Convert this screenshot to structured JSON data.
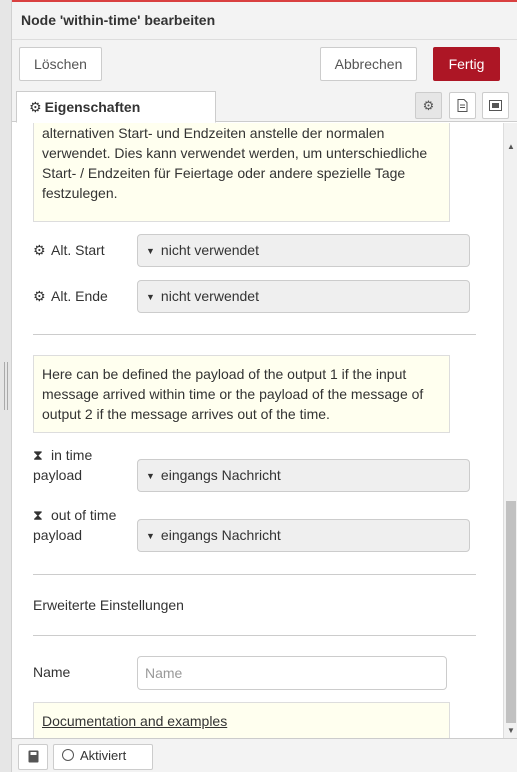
{
  "dialog": {
    "title": "Node 'within-time' bearbeiten"
  },
  "toolbar": {
    "delete_label": "Löschen",
    "cancel_label": "Abbrechen",
    "done_label": "Fertig"
  },
  "tabs": {
    "properties_label": "Eigenschaften",
    "icons": [
      "gear-icon",
      "document-icon",
      "image-icon"
    ]
  },
  "tips": {
    "alt_times": "alternativen Start- und Endzeiten anstelle der normalen verwendet. Dies kann verwendet werden, um unterschiedliche Start- / Endzeiten für Feiertage oder andere spezielle Tage festzulegen.",
    "payload": "Here can be defined the payload of the output 1 if the input message arrived within time or the payload of the message of output 2 if the message arrives out of the time.",
    "doc_link": "Documentation and examples"
  },
  "fields": {
    "alt_start": {
      "label": "Alt. Start",
      "value": "nicht verwendet",
      "icon": "gear-icon"
    },
    "alt_end": {
      "label": "Alt. Ende",
      "value": "nicht verwendet",
      "icon": "gear-icon"
    },
    "in_time_payload": {
      "label_line1": "in time",
      "label_line2": "payload",
      "value": "eingangs Nachricht",
      "icon": "hourglass-icon"
    },
    "out_time_payload": {
      "label_line1": "out of time",
      "label_line2": "payload",
      "value": "eingangs Nachricht",
      "icon": "hourglass-icon"
    },
    "name": {
      "label": "Name",
      "value": "",
      "placeholder": "Name"
    }
  },
  "advanced": {
    "label": "Erweiterte Einstellungen"
  },
  "footer": {
    "toggle_label": "Aktiviert"
  },
  "colors": {
    "accent": "#ad1625",
    "tip_background": "#ffffef"
  }
}
